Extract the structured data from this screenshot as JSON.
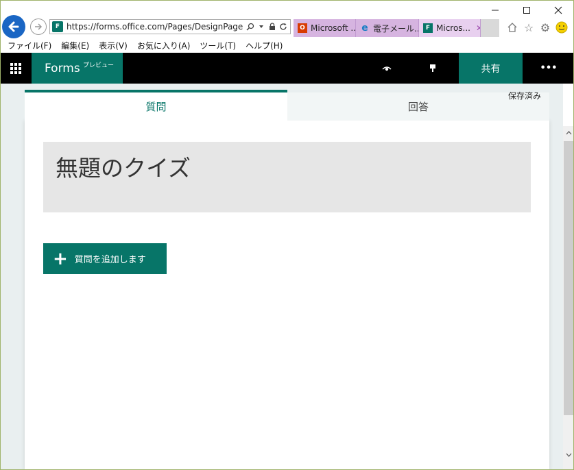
{
  "browser": {
    "address_url": "https://forms.office.com/Pages/DesignPage.aspx",
    "tabs": [
      {
        "label": "Microsoft ...",
        "icon": "office-icon"
      },
      {
        "label": "電子メール...",
        "icon": "ie-icon"
      },
      {
        "label": "Micros...",
        "icon": "forms-icon",
        "active": true
      }
    ],
    "menu": [
      "ファイル(F)",
      "編集(E)",
      "表示(V)",
      "お気に入り(A)",
      "ツール(T)",
      "ヘルプ(H)"
    ]
  },
  "app": {
    "brand": "Forms",
    "brand_tag": "プレビュー",
    "share_label": "共有",
    "more_label": "•••",
    "accent": "#077568"
  },
  "editor": {
    "tabs": [
      "質問",
      "回答"
    ],
    "saved_status": "保存済み",
    "quiz_title": "無題のクイズ",
    "add_question_label": "質問を追加します",
    "add_icon": "+"
  }
}
